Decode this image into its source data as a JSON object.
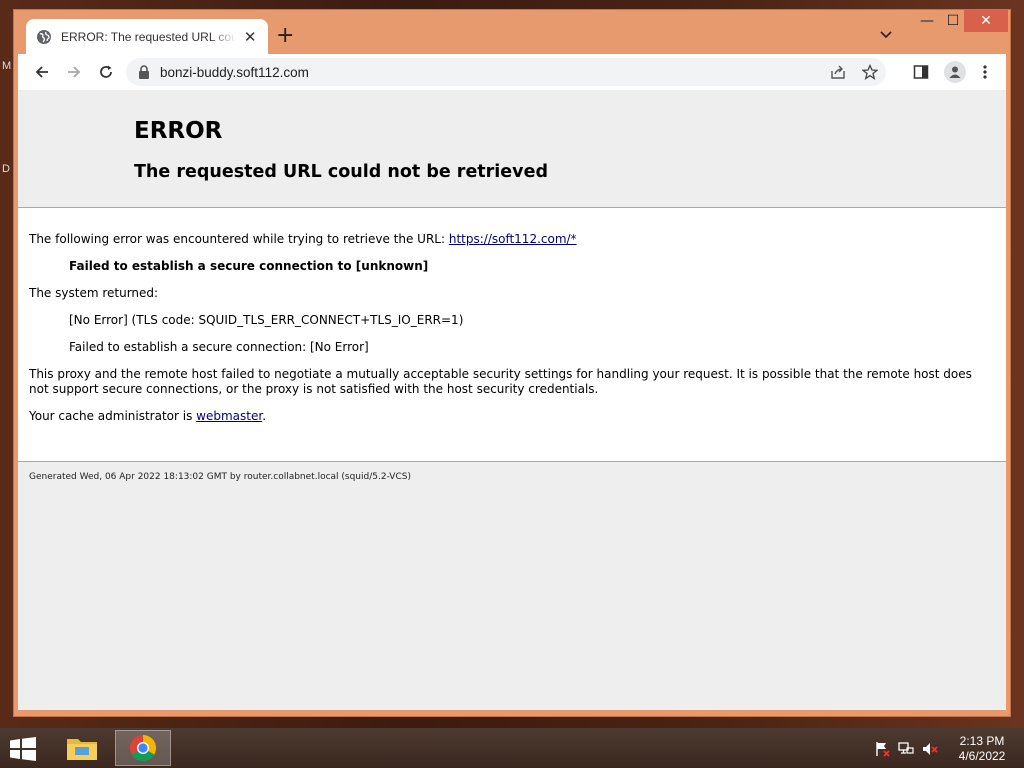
{
  "desktop": {
    "edge_labels": [
      "M",
      "D"
    ]
  },
  "browser": {
    "tab": {
      "title": "ERROR: The requested URL could not be retrieved",
      "close_glyph": "✕",
      "favicon": "globe-icon"
    },
    "new_tab_glyph": "+",
    "window_controls": {
      "minimize": "—",
      "maximize": "☐",
      "close": "✕"
    },
    "address_bar": {
      "url": "bonzi-buddy.soft112.com"
    }
  },
  "page": {
    "heading": "ERROR",
    "subheading": "The requested URL could not be retrieved",
    "intro_text": "The following error was encountered while trying to retrieve the URL: ",
    "intro_link": "https://soft112.com/*",
    "error_title": "Failed to establish a secure connection to [unknown]",
    "system_returned_label": "The system returned:",
    "system_error_code": "[No Error] (TLS code: SQUID_TLS_ERR_CONNECT+TLS_IO_ERR=1)",
    "system_error_detail": "Failed to establish a secure connection: [No Error]",
    "explanation": "This proxy and the remote host failed to negotiate a mutually acceptable security settings for handling your request. It is possible that the remote host does not support secure connections, or the proxy is not satisfied with the host security credentials.",
    "admin_prefix": "Your cache administrator is ",
    "admin_link": "webmaster",
    "admin_suffix": ".",
    "footer": "Generated Wed, 06 Apr 2022 18:13:02 GMT by router.collabnet.local (squid/5.2-VCS)"
  },
  "taskbar": {
    "apps": [
      "file-explorer",
      "chrome"
    ],
    "tray_icons": [
      "action-center-flag-icon",
      "network-icon",
      "volume-muted-icon"
    ],
    "clock": {
      "time": "2:13 PM",
      "date": "4/6/2022"
    }
  },
  "colors": {
    "accent": "#e69a6e",
    "link": "#000080",
    "header_bg": "#eeeeee"
  }
}
